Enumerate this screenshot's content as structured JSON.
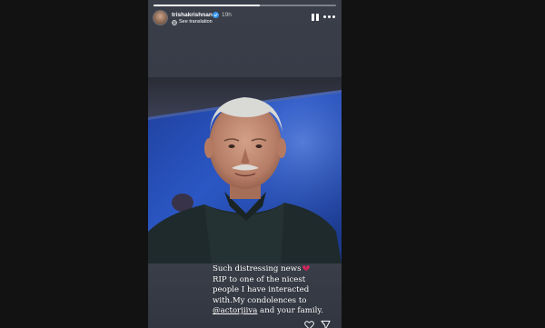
{
  "story": {
    "progress": 0.58,
    "username": "trishakrishnan",
    "verified": true,
    "time_ago": "19h",
    "see_translation": "See translation",
    "caption": {
      "line1": "Such distressing news",
      "line2": "RIP to one of the nicest",
      "line3": "people I have interacted",
      "line4": "with.My condolences to",
      "mention": "@actorjiiva",
      "line5_rest": " and your family."
    }
  },
  "icons": {
    "avatar": "profile-avatar",
    "verified": "verified-badge-icon",
    "globe": "globe-icon",
    "pause": "pause-icon",
    "more": "more-options-icon",
    "broken_heart": "broken-heart-emoji",
    "like": "heart-icon",
    "send": "send-icon"
  },
  "colors": {
    "page_background": "#121212",
    "story_background": "#3a3e49",
    "text": "#ffffff",
    "verified_badge": "#3797f0",
    "broken_heart": "#e0245e"
  }
}
